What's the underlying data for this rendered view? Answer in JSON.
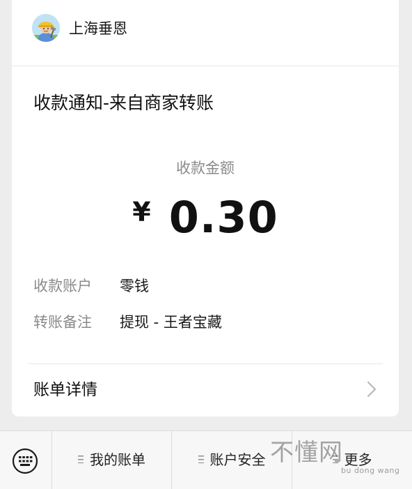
{
  "sender": {
    "name": "上海垂恩",
    "avatar_icon": "cartoon-worker-avatar"
  },
  "notice": {
    "title": "收款通知-来自商家转账"
  },
  "amount": {
    "label": "收款金额",
    "currency": "¥",
    "value": "0.30"
  },
  "details": [
    {
      "label": "收款账户",
      "value": "零钱"
    },
    {
      "label": "转账备注",
      "value": "提现 - 王者宝藏"
    }
  ],
  "bill_detail": {
    "label": "账单详情",
    "icon": "chevron-right-icon"
  },
  "bottom_menu": {
    "keyboard_icon": "keyboard-icon",
    "items": [
      {
        "label": "我的账单"
      },
      {
        "label": "账户安全"
      },
      {
        "label": "更多"
      }
    ]
  },
  "watermark": {
    "text": "不懂网",
    "subtext": "bu dong wang"
  },
  "colors": {
    "background": "#ededed",
    "card": "#ffffff",
    "muted_text": "#8a8a8a",
    "primary_text": "#111111"
  }
}
